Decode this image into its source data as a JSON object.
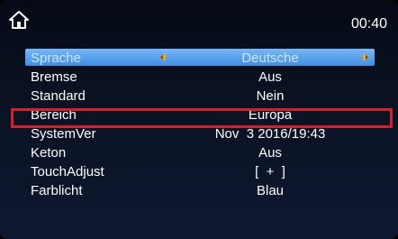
{
  "header": {
    "home_icon": "home-icon",
    "clock": "00:40"
  },
  "menu": {
    "items": [
      {
        "label": "Sprache",
        "value": "Deutsche",
        "selected": true,
        "arrows": true
      },
      {
        "label": "Bremse",
        "value": "Aus"
      },
      {
        "label": "Standard",
        "value": "Nein"
      },
      {
        "label": "Bereich",
        "value": "Europa",
        "highlighted": true
      },
      {
        "label": "SystemVer",
        "value": "Nov  3 2016/19:43"
      },
      {
        "label": "Keton",
        "value": "Aus"
      },
      {
        "label": "TouchAdjust",
        "value": "[  +  ]"
      },
      {
        "label": "Farblicht",
        "value": "Blau"
      }
    ]
  },
  "colors": {
    "selection_highlight": "#4a97ea",
    "annotation_box": "#d4202a",
    "arrow_icon": "#e5a823"
  }
}
